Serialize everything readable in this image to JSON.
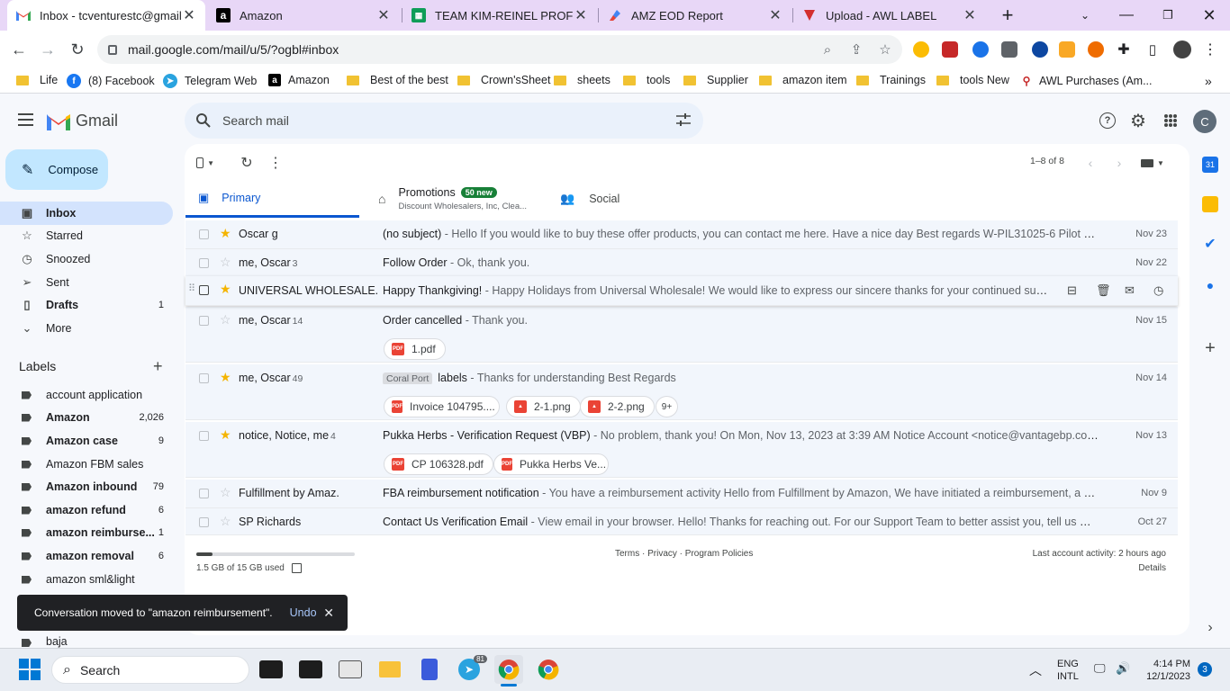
{
  "browser": {
    "tabs": [
      {
        "title": "Inbox - tcventurestc@gmail.",
        "icon": "gmail-icon",
        "active": true
      },
      {
        "title": "Amazon",
        "icon": "amazon-icon"
      },
      {
        "title": "TEAM KIM-REINEL PROFIT S",
        "icon": "sheets-icon"
      },
      {
        "title": "AMZ EOD Report",
        "icon": "report-icon"
      },
      {
        "title": "Upload - AWL LABEL",
        "icon": "awl-icon"
      }
    ],
    "new_tab": "+",
    "url": "mail.google.com/mail/u/5/?ogbl#inbox",
    "bookmarks": [
      {
        "label": "Life",
        "icon": "folder-icon"
      },
      {
        "label": "(8) Facebook",
        "icon": "facebook-icon"
      },
      {
        "label": "Telegram Web",
        "icon": "telegram-icon"
      },
      {
        "label": "Amazon",
        "icon": "amazon-icon"
      },
      {
        "label": "Best of the best",
        "icon": "folder-icon"
      },
      {
        "label": "Crown'sSheet",
        "icon": "folder-icon"
      },
      {
        "label": "sheets",
        "icon": "folder-icon"
      },
      {
        "label": "tools",
        "icon": "folder-icon"
      },
      {
        "label": "Supplier",
        "icon": "folder-icon"
      },
      {
        "label": "amazon item",
        "icon": "folder-icon"
      },
      {
        "label": "Trainings",
        "icon": "folder-icon"
      },
      {
        "label": "tools New",
        "icon": "folder-icon"
      },
      {
        "label": "AWL Purchases (Am...",
        "icon": "awl-icon"
      }
    ]
  },
  "gmail": {
    "logo_text": "Gmail",
    "search_placeholder": "Search mail",
    "account_initial": "C",
    "compose_label": "Compose",
    "nav": [
      {
        "label": "Inbox",
        "icon": "inbox-icon",
        "count": "",
        "selected": true
      },
      {
        "label": "Starred",
        "icon": "star-icon",
        "count": ""
      },
      {
        "label": "Snoozed",
        "icon": "clock-icon",
        "count": ""
      },
      {
        "label": "Sent",
        "icon": "send-icon",
        "count": ""
      },
      {
        "label": "Drafts",
        "icon": "draft-icon",
        "count": "1"
      },
      {
        "label": "More",
        "icon": "chevron-down-icon",
        "count": ""
      }
    ],
    "labels_title": "Labels",
    "labels": [
      {
        "label": "account application",
        "count": "",
        "bold": false
      },
      {
        "label": "Amazon",
        "count": "2,026",
        "bold": true
      },
      {
        "label": "Amazon case",
        "count": "9",
        "bold": true
      },
      {
        "label": "Amazon FBM sales",
        "count": "",
        "bold": false
      },
      {
        "label": "Amazon inbound",
        "count": "79",
        "bold": true
      },
      {
        "label": "amazon refund",
        "count": "6",
        "bold": true
      },
      {
        "label": "amazon reimburse...",
        "count": "1",
        "bold": true
      },
      {
        "label": "amazon removal",
        "count": "6",
        "bold": true
      },
      {
        "label": "amazon sml&light",
        "count": "",
        "bold": false
      },
      {
        "label": "baja",
        "count": "",
        "bold": false
      }
    ],
    "pagination": "1–8 of 8",
    "tabs": [
      {
        "label": "Primary",
        "icon": "inbox-icon",
        "active": true
      },
      {
        "label": "Promotions",
        "badge": "50 new",
        "sub": "Discount Wholesalers, Inc, Clea...",
        "icon": "tag-icon"
      },
      {
        "label": "Social",
        "icon": "people-icon"
      }
    ],
    "emails": [
      {
        "sender": "Oscar g",
        "count": "",
        "starred": true,
        "subject": "(no subject)",
        "snippet": " - Hello If you would like to buy these offer products, you can contact me here. Have a nice day Best regards W-PIL31025-6 Pilot G2 Premium R...",
        "date": "Nov 23",
        "chip": "",
        "attachments": []
      },
      {
        "sender": "me, Oscar",
        "count": "3",
        "starred": false,
        "subject": "Follow Order",
        "snippet": " - Ok, thank you.",
        "date": "Nov 22",
        "chip": "",
        "attachments": []
      },
      {
        "sender": "UNIVERSAL WHOLESALE.",
        "count": "",
        "starred": true,
        "subject": "Happy Thankgiving!",
        "snippet": " - Happy Holidays from Universal Wholesale! We would like to express our sincere thanks for your continued support. We are t...",
        "date": "",
        "chip": "",
        "attachments": [],
        "hover": true
      },
      {
        "sender": "me, Oscar",
        "count": "14",
        "starred": false,
        "subject": "Order cancelled",
        "snippet": " - Thank you.",
        "date": "Nov 15",
        "chip": "",
        "attachments": [
          {
            "name": "1.pdf",
            "type": "pdf"
          }
        ]
      },
      {
        "sender": "me, Oscar",
        "count": "49",
        "starred": true,
        "subject": "labels",
        "snippet": " - Thanks for understanding Best Regards",
        "date": "Nov 14",
        "chip": "Coral Port",
        "attachments": [
          {
            "name": "Invoice 104795....",
            "type": "pdf"
          },
          {
            "name": "2-1.png",
            "type": "img"
          },
          {
            "name": "2-2.png",
            "type": "img"
          }
        ],
        "more": "9+"
      },
      {
        "sender": "notice, Notice, me",
        "count": "4",
        "starred": true,
        "subject": "Pukka Herbs - Verification Request (VBP)",
        "snippet": " - No problem, thank you! On Mon, Nov 13, 2023 at 3:39 AM Notice Account <notice@vantagebp.com> wrote: Hi AL...",
        "date": "Nov 13",
        "chip": "",
        "attachments": [
          {
            "name": "CP 106328.pdf",
            "type": "pdf"
          },
          {
            "name": "Pukka Herbs Ve...",
            "type": "pdf"
          }
        ]
      },
      {
        "sender": "Fulfillment by Amaz.",
        "count": "",
        "starred": false,
        "subject": "FBA reimbursement notification",
        "snippet": " - You have a reimbursement activity Hello from Fulfillment by Amazon, We have initiated a reimbursement, a reimbursement...",
        "date": "Nov 9",
        "chip": "",
        "attachments": []
      },
      {
        "sender": "SP Richards",
        "count": "",
        "starred": false,
        "subject": "Contact Us Verification Email",
        "snippet": " - View email in your browser. Hello! Thanks for reaching out. For our Support Team to better assist you, tell us more about your...",
        "date": "Oct 27",
        "chip": "",
        "attachments": []
      }
    ],
    "storage_text": "1.5 GB of 15 GB used",
    "storage_fraction": 0.1,
    "footer_links": "Terms · Privacy · Program Policies",
    "last_activity": "Last account activity: 2 hours ago",
    "details_link": "Details",
    "toast": {
      "message": "Conversation moved to \"amazon reimbursement\".",
      "undo": "Undo"
    }
  },
  "taskbar": {
    "search_placeholder": "Search",
    "telegram_badge": "81",
    "lang_line1": "ENG",
    "lang_line2": "INTL",
    "time": "4:14 PM",
    "date": "12/1/2023",
    "notification_count": "3"
  },
  "colors": {
    "accent": "#0b57d0",
    "compose": "#c2e7ff",
    "star": "#f4b400",
    "tab_strip": "#e8d7f7"
  }
}
